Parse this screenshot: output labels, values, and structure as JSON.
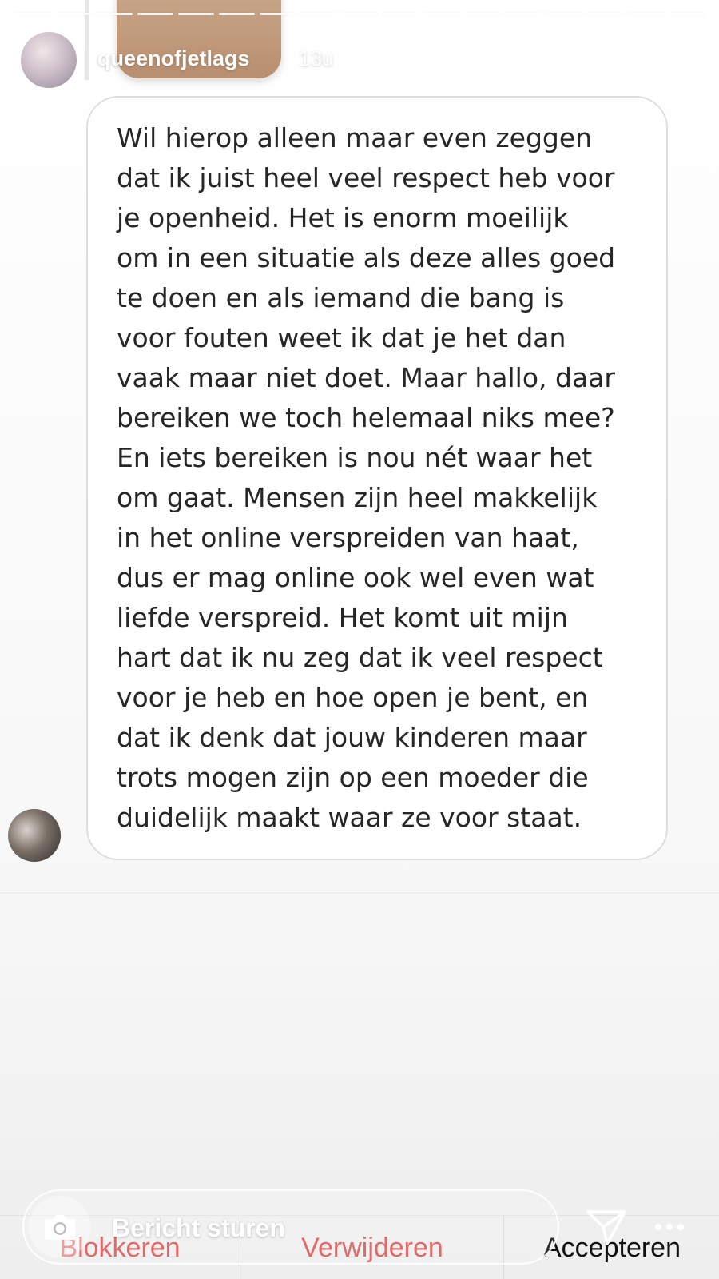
{
  "story": {
    "segments_total": 17,
    "segments_viewed": 13
  },
  "header": {
    "username": "queenofjetlags",
    "time": "13u",
    "close_icon": "close-icon"
  },
  "message": {
    "lines": [
      "Wil hierop alleen maar even zeggen",
      "dat ik juist heel veel respect heb voor",
      "je openheid. Het is enorm moeilijk",
      "om in een situatie als deze alles goed",
      "te doen en als iemand die bang is",
      "voor fouten weet ik dat je het dan",
      "vaak maar niet doet. Maar hallo, daar",
      "bereiken we toch helemaal niks mee?",
      "En iets bereiken is nou nét waar het",
      "om gaat. Mensen zijn heel makkelijk",
      "in het online verspreiden van haat,",
      "dus er mag online ook wel even wat",
      "liefde verspreid. Het komt uit mijn",
      "hart dat ik nu zeg dat ik veel respect",
      "voor je heb en hoe open je bent, en",
      "dat ik denk dat jouw kinderen maar",
      "trots mogen zijn op een moeder die",
      "duidelijk maakt waar ze voor staat."
    ]
  },
  "actions": {
    "block": "Blokkeren",
    "delete": "Verwijderen",
    "accept": "Accepteren"
  },
  "reply": {
    "placeholder": "Bericht sturen",
    "camera_icon": "camera-icon",
    "send_icon": "send-icon",
    "more_icon": "more-icon"
  },
  "colors": {
    "destructive": "#e05555",
    "bubble_border": "#dedede",
    "text": "#262626"
  }
}
